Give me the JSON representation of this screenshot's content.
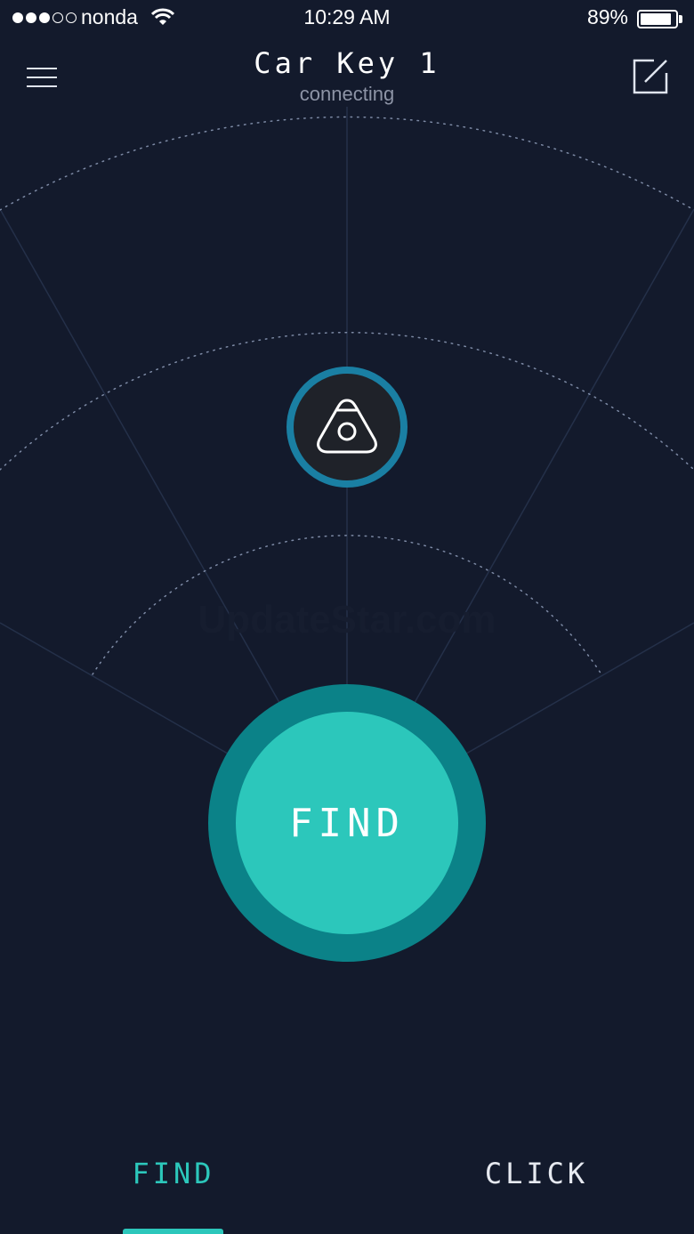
{
  "status_bar": {
    "carrier": "nonda",
    "time": "10:29 AM",
    "battery_percent": "89%",
    "battery_level": 0.89,
    "signal_bars_filled": 3,
    "signal_bars_total": 5
  },
  "header": {
    "title": "Car Key 1",
    "subtitle": "connecting",
    "menu_icon": "hamburger-menu-icon",
    "edit_icon": "edit-icon"
  },
  "device": {
    "icon": "triangle-tag-icon"
  },
  "main": {
    "find_button_label": "FIND",
    "watermark": "UpdateStar.com"
  },
  "tabs": [
    {
      "label": "FIND",
      "active": true
    },
    {
      "label": "CLICK",
      "active": false
    }
  ],
  "colors": {
    "background": "#131a2c",
    "accent": "#2cc7bb",
    "accent_dark": "#0b8288",
    "device_ring": "#1a7fa3",
    "muted_text": "#8d94a6"
  }
}
